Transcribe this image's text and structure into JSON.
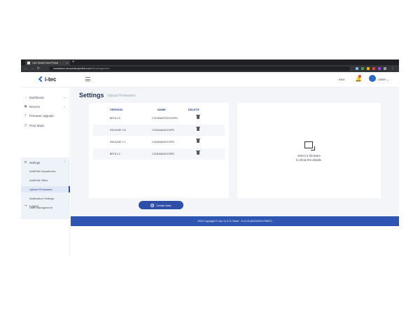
{
  "browser": {
    "tab_title": "i-tec Smart Dock Portal",
    "tab_close": "×",
    "new_tab": "+",
    "url_host": "smartdock-dev.portal.apixlink.com",
    "url_path": "/fWmanagement"
  },
  "header": {
    "logo": "i-tec",
    "lang": "ENG",
    "user": "USER"
  },
  "sidebar": {
    "items": [
      {
        "label": "Dashboard",
        "icon": "dashboard-icon",
        "glyph": "◔",
        "chevron": "⌄"
      },
      {
        "label": "Devices",
        "icon": "devices-icon",
        "glyph": "▣",
        "chevron": "⌄"
      },
      {
        "label": "Firmware Upgrade",
        "icon": "upgrade-icon",
        "glyph": "⇪",
        "chevron": ""
      },
      {
        "label": "Floor Maps",
        "icon": "map-icon",
        "glyph": "◫",
        "chevron": ""
      }
    ],
    "settings": {
      "label": "Settings",
      "icon": "gear-icon",
      "glyph": "⚙",
      "chevron": "⌃"
    },
    "settings_sub": [
      {
        "label": "Add/Edit Department"
      },
      {
        "label": "Add/Edit Office"
      },
      {
        "label": "Upload Firmwares",
        "active": true
      },
      {
        "label": "Notification Settings"
      },
      {
        "label": "User Management"
      }
    ],
    "logout": {
      "label": "Logout",
      "icon": "logout-icon",
      "glyph": "⇥"
    }
  },
  "main": {
    "title": "Settings",
    "subtitle": "Upload Firmwares",
    "columns": [
      "VERSION",
      "NAME",
      "DELETE"
    ],
    "rows": [
      {
        "version": "BETA 3.5",
        "name": "C31SMARTEDOCKPD"
      },
      {
        "version": "RELEASE 3.6",
        "name": "C31NANADOCKPD"
      },
      {
        "version": "RELEASE 2.1",
        "name": "C31NANADOCKPD"
      },
      {
        "version": "BETA 1.2",
        "name": "C31NANADOCKPD"
      }
    ],
    "create_label": "Create New",
    "detail_line1": "Select a firmware",
    "detail_line2": "to show the details."
  },
  "footer": {
    "text": "2022 Copyright © i-tec v1.3.7c Client · v1.3.19 (20220329-070827)"
  },
  "colors": {
    "accent": "#2d4fa8",
    "footer": "#2e55b2",
    "browser_chrome": "#202124"
  }
}
